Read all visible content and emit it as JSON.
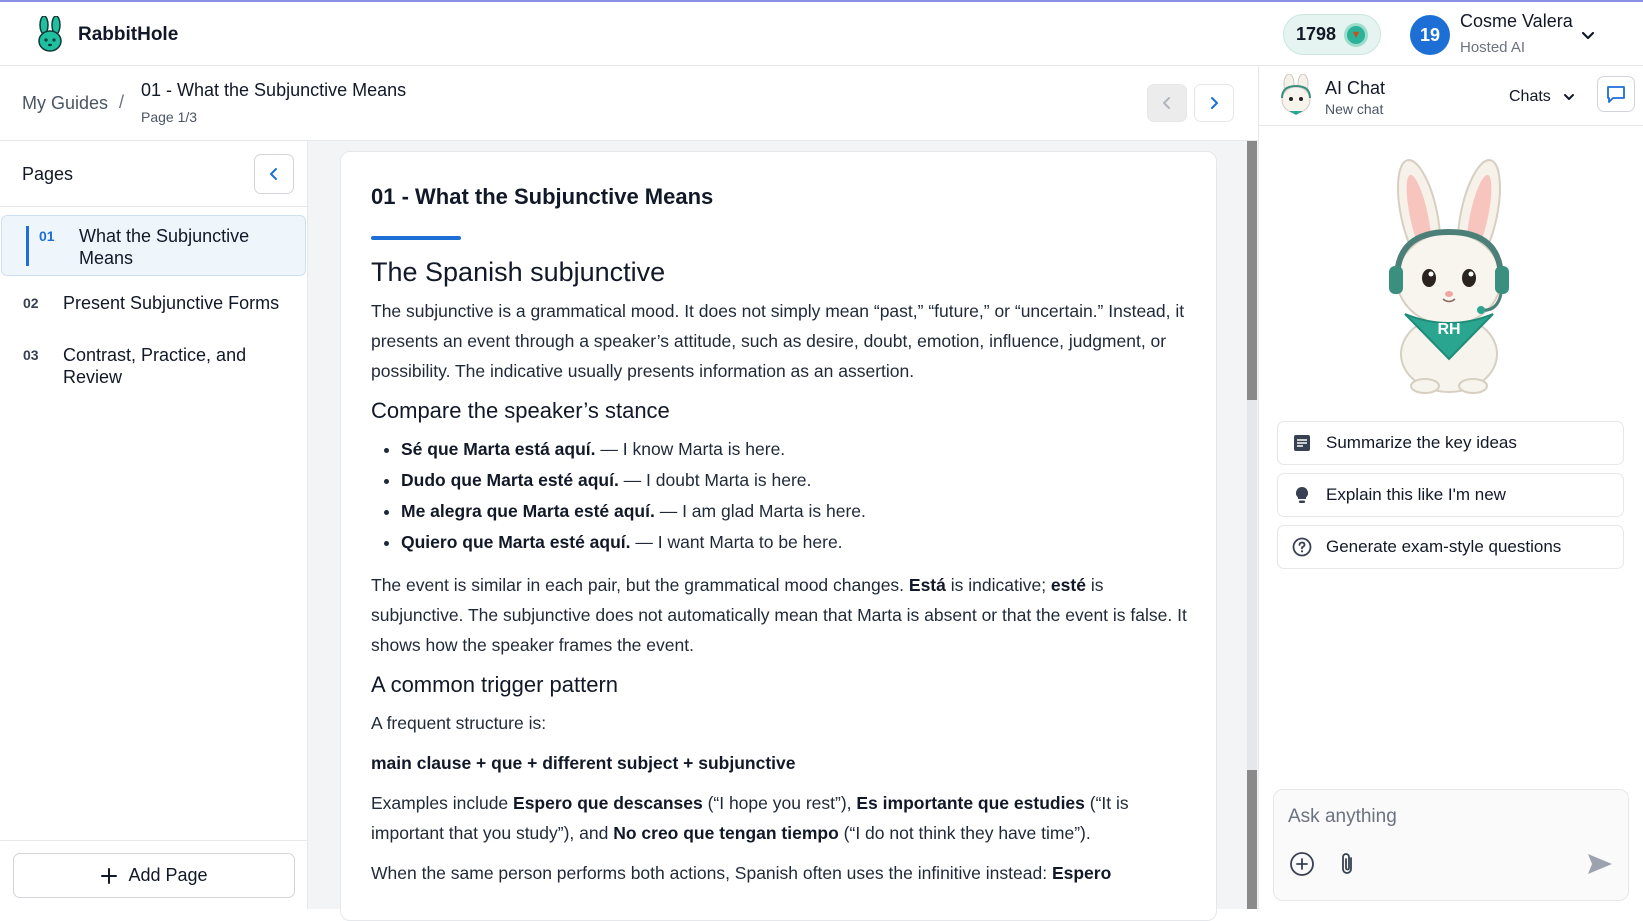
{
  "app": {
    "brand": "RabbitHole",
    "credits": "1798"
  },
  "user": {
    "initials": "19",
    "name": "Cosme Valera",
    "plan": "Hosted AI"
  },
  "breadcrumb": {
    "root": "My Guides",
    "separator": "/",
    "title": "01 - What the Subjunctive Means",
    "page": "Page 1/3"
  },
  "pages": {
    "title": "Pages",
    "items": [
      {
        "num": "01",
        "label": "What the Subjunctive Means",
        "active": true
      },
      {
        "num": "02",
        "label": "Present Subjunctive Forms",
        "active": false
      },
      {
        "num": "03",
        "label": "Contrast, Practice, and Review",
        "active": false
      }
    ],
    "add_label": "Add Page"
  },
  "doc": {
    "title": "01 - What the Subjunctive Means",
    "h_main": "The Spanish subjunctive",
    "p1": "The subjunctive is a grammatical mood. It does not simply mean “past,” “future,” or “uncertain.” Instead, it presents an event through a speaker’s attitude, such as desire, doubt, emotion, influence, judgment, or possibility. The indicative usually presents information as an assertion.",
    "h_compare": "Compare the speaker’s stance",
    "examples": [
      {
        "es": "Sé que Marta está aquí.",
        "en": " — I know Marta is here."
      },
      {
        "es": "Dudo que Marta esté aquí.",
        "en": " — I doubt Marta is here."
      },
      {
        "es": "Me alegra que Marta esté aquí.",
        "en": " — I am glad Marta is here."
      },
      {
        "es": "Quiero que Marta esté aquí.",
        "en": " — I want Marta to be here."
      }
    ],
    "p2_a": "The event is similar in each pair, but the grammatical mood changes. ",
    "p2_b1": "Está",
    "p2_c": " is indicative; ",
    "p2_b2": "esté",
    "p2_d": " is subjunctive. The subjunctive does not automatically mean that Marta is absent or that the event is false. It shows how the speaker frames the event.",
    "h_trigger": "A common trigger pattern",
    "p3": "A frequent structure is:",
    "formula": "main clause + que + different subject + subjunctive",
    "p4_a": "Examples include ",
    "p4_b1": "Espero que descanses",
    "p4_c": " (“I hope you rest”), ",
    "p4_b2": "Es importante que estudies",
    "p4_d": " (“It is important that you study”), and ",
    "p4_b3": "No creo que tengan tiempo",
    "p4_e": " (“I do not think they have time”).",
    "p5_a": "When the same person performs both actions, Spanish often uses the infinitive instead: ",
    "p5_b": "Espero"
  },
  "chat": {
    "title": "AI Chat",
    "subtitle": "New chat",
    "dropdown": "Chats",
    "suggestions": [
      "Summarize the key ideas",
      "Explain this like I'm new",
      "Generate exam-style questions"
    ],
    "input_placeholder": "Ask anything",
    "mascot_badge": "RH"
  },
  "colors": {
    "accent": "#1d6fd6",
    "brand_teal": "#2bb39a"
  }
}
